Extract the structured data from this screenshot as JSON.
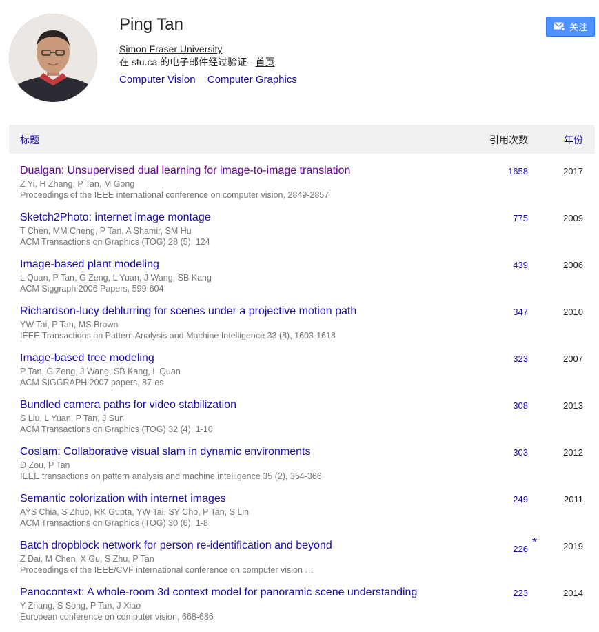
{
  "profile": {
    "name": "Ping Tan",
    "affiliation": "Simon Fraser University",
    "verified_prefix": "在 sfu.ca 的电子邮件经过验证 - ",
    "homepage_label": "首页",
    "interests": [
      "Computer Vision",
      "Computer Graphics"
    ]
  },
  "follow_button": {
    "label": "关注",
    "icon": "mail-icon"
  },
  "table": {
    "col_title": "标题",
    "col_cited": "引用次数",
    "col_year": "年份",
    "rows": [
      {
        "title": "Dualgan: Unsupervised dual learning for image-to-image translation",
        "authors": "Z Yi, H Zhang, P Tan, M Gong",
        "venue": "Proceedings of the IEEE international conference on computer vision, 2849-2857",
        "cites": "1658",
        "year": "2017"
      },
      {
        "title": "Sketch2Photo: internet image montage",
        "authors": "T Chen, MM Cheng, P Tan, A Shamir, SM Hu",
        "venue": "ACM Transactions on Graphics (TOG) 28 (5), 124",
        "cites": "775",
        "year": "2009"
      },
      {
        "title": "Image-based plant modeling",
        "authors": "L Quan, P Tan, G Zeng, L Yuan, J Wang, SB Kang",
        "venue": "ACM Siggraph 2006 Papers, 599-604",
        "cites": "439",
        "year": "2006"
      },
      {
        "title": "Richardson-lucy deblurring for scenes under a projective motion path",
        "authors": "YW Tai, P Tan, MS Brown",
        "venue": "IEEE Transactions on Pattern Analysis and Machine Intelligence 33 (8), 1603-1618",
        "cites": "347",
        "year": "2010"
      },
      {
        "title": "Image-based tree modeling",
        "authors": "P Tan, G Zeng, J Wang, SB Kang, L Quan",
        "venue": "ACM SIGGRAPH 2007 papers, 87-es",
        "cites": "323",
        "year": "2007"
      },
      {
        "title": "Bundled camera paths for video stabilization",
        "authors": "S Liu, L Yuan, P Tan, J Sun",
        "venue": "ACM Transactions on Graphics (TOG) 32 (4), 1-10",
        "cites": "308",
        "year": "2013"
      },
      {
        "title": "Coslam: Collaborative visual slam in dynamic environments",
        "authors": "D Zou, P Tan",
        "venue": "IEEE transactions on pattern analysis and machine intelligence 35 (2), 354-366",
        "cites": "303",
        "year": "2012"
      },
      {
        "title": "Semantic colorization with internet images",
        "authors": "AYS Chia, S Zhuo, RK Gupta, YW Tai, SY Cho, P Tan, S Lin",
        "venue": "ACM Transactions on Graphics (TOG) 30 (6), 1-8",
        "cites": "249",
        "year": "2011"
      },
      {
        "title": "Batch dropblock network for person re-identification and beyond",
        "authors": "Z Dai, M Chen, X Gu, S Zhu, P Tan",
        "venue": "Proceedings of the IEEE/CVF international conference on computer vision …",
        "cites": "226",
        "star": "*",
        "year": "2019"
      },
      {
        "title": "Panocontext: A whole-room 3d context model for panoramic scene understanding",
        "authors": "Y Zhang, S Song, P Tan, J Xiao",
        "venue": "European conference on computer vision, 668-686",
        "cites": "223",
        "year": "2014"
      }
    ]
  }
}
